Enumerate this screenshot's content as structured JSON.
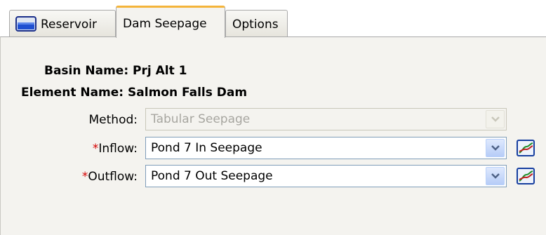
{
  "tabs": [
    {
      "label": "Reservoir",
      "icon": "reservoir-icon"
    },
    {
      "label": "Dam Seepage",
      "selected": true
    },
    {
      "label": "Options"
    }
  ],
  "info": {
    "basin_name": "Basin Name: Prj Alt 1",
    "element_name": "Element Name: Salmon Falls Dam"
  },
  "fields": {
    "method": {
      "label": "Method:",
      "value": "Tabular Seepage",
      "enabled": false
    },
    "inflow": {
      "required_mark": "*",
      "label": "Inflow:",
      "value": "Pond 7 In Seepage",
      "enabled": true
    },
    "outflow": {
      "required_mark": "*",
      "label": "Outflow:",
      "value": "Pond 7 Out Seepage",
      "enabled": true
    }
  },
  "colors": {
    "selected_tab_accent": "#f4b43a",
    "required_mark": "#d40000",
    "panel_background": "#f4f3ef"
  }
}
